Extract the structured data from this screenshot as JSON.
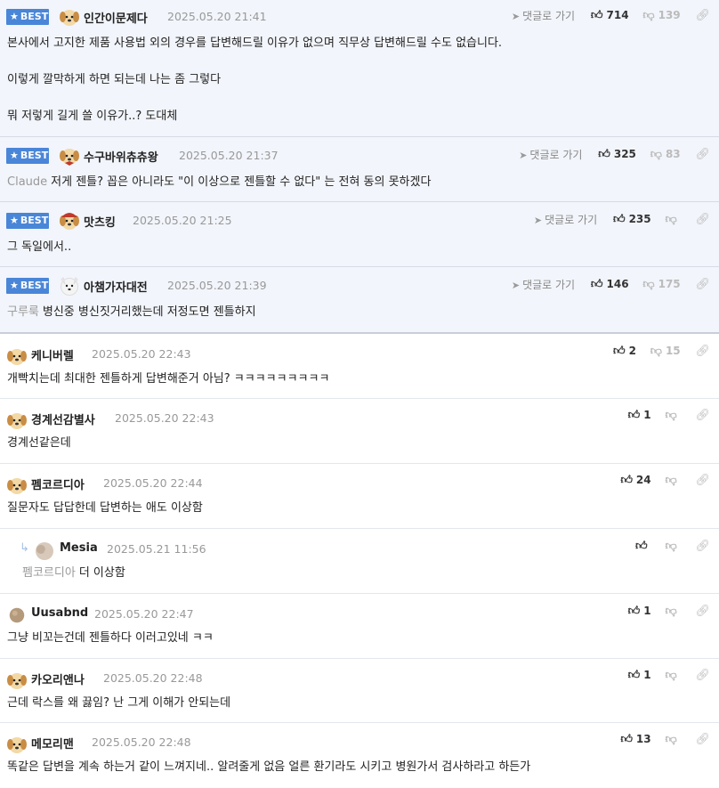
{
  "labels": {
    "best": "BEST",
    "goto_comment": "댓글로 가기"
  },
  "comments": [
    {
      "nick": "인간이문제다",
      "date": "2025.05.20 21:41",
      "up": "714",
      "down": "139",
      "paragraphs": [
        "본사에서 고지한 제품 사용법 외의 경우를 답변해드릴 이유가 없으며 직무상 답변해드릴 수도 없습니다.",
        "이렇게 깔막하게 하면 되는데 나는 좀 그렇다",
        "뭐 저렇게 길게 쓸 이유가..? 도대체"
      ]
    },
    {
      "nick": "수구바위츄츄왕",
      "date": "2025.05.20 21:37",
      "up": "325",
      "down": "83",
      "mention": "Claude",
      "text": "저게 젠틀? 꼽은 아니라도 \"이 이상으로 젠틀할 수 없다\" 는 전혀 동의 못하겠다"
    },
    {
      "nick": "맛츠킹",
      "date": "2025.05.20 21:25",
      "up": "235",
      "down": "",
      "text": "그 독일에서.."
    },
    {
      "nick": "아챔가자대전",
      "date": "2025.05.20 21:39",
      "up": "146",
      "down": "175",
      "mention": "구루룩",
      "text": "병신중 병신짓거리했는데 저정도면 젠틀하지"
    },
    {
      "nick": "케니버렐",
      "date": "2025.05.20 22:43",
      "up": "2",
      "down": "15",
      "text": "개빡치는데 최대한 젠틀하게 답변해준거 아님? ㅋㅋㅋㅋㅋㅋㅋㅋㅋ"
    },
    {
      "nick": "경계선감별사",
      "date": "2025.05.20 22:43",
      "up": "1",
      "down": "",
      "text": "경계선같은데"
    },
    {
      "nick": "펨코르디아",
      "date": "2025.05.20 22:44",
      "up": "24",
      "down": "",
      "text": "질문자도 답답한데 답변하는 애도 이상함"
    },
    {
      "nick": "Mesia",
      "date": "2025.05.21 11:56",
      "up": "",
      "down": "",
      "mention": "펨코르디아",
      "text": "더 이상함"
    },
    {
      "nick": "Uusabnd",
      "date": "2025.05.20 22:47",
      "up": "1",
      "down": "",
      "text": "그냥 비꼬는건데 젠틀하다 이러고있네 ㅋㅋ"
    },
    {
      "nick": "카오리앤나",
      "date": "2025.05.20 22:48",
      "up": "1",
      "down": "",
      "text": "근데 락스를 왜 끓임? 난 그게 이해가 안되는데"
    },
    {
      "nick": "메모리맨",
      "date": "2025.05.20 22:48",
      "up": "13",
      "down": "",
      "text": "똑같은 답변을 계속 하는거 같이 느껴지네.. 알려줄게 없음 얼른 환기라도 시키고 병원가서 검사하라고 하든가"
    }
  ],
  "icons": {
    "best": "star-icon",
    "goto": "send-arrow-icon",
    "up": "thumb-up-icon",
    "down": "thumb-down-icon",
    "link": "link-icon",
    "reply": "reply-arrow-icon"
  },
  "colors": {
    "best_badge": "#4a86d8",
    "best_bg": "#f2f5fb",
    "date": "#999999",
    "mention": "#999999"
  }
}
